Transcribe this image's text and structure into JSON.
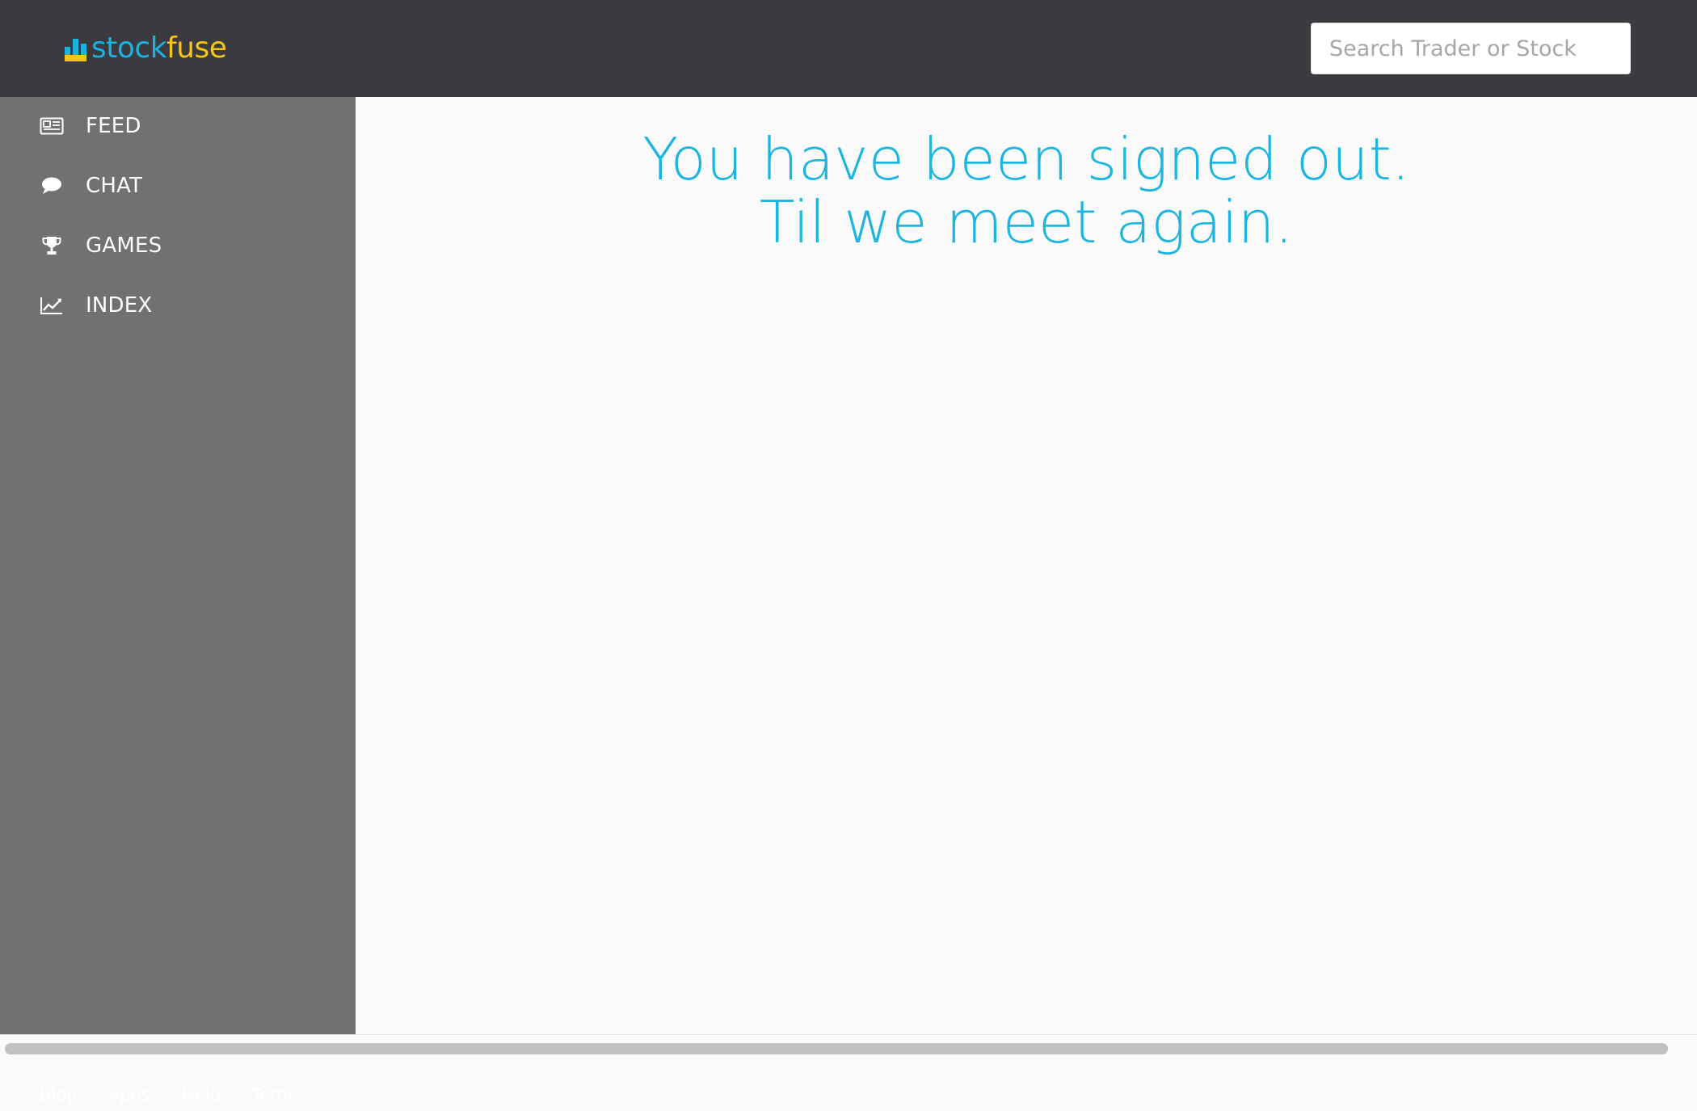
{
  "header": {
    "logo": {
      "part1": "stock",
      "part2": "fuse",
      "colors": {
        "stock": "#1bb4e0",
        "fuse": "#f5c518"
      }
    },
    "search": {
      "placeholder": "Search Trader or Stock",
      "value": ""
    }
  },
  "sidebar": {
    "items": [
      {
        "label": "FEED",
        "icon": "newspaper-icon"
      },
      {
        "label": "CHAT",
        "icon": "speech-bubble-icon"
      },
      {
        "label": "GAMES",
        "icon": "trophy-icon"
      },
      {
        "label": "INDEX",
        "icon": "line-chart-icon"
      }
    ],
    "footer": [
      {
        "label": "Blog"
      },
      {
        "label": "Apps"
      },
      {
        "label": "Help"
      },
      {
        "label": "Terms"
      }
    ]
  },
  "main": {
    "message_line1": "You have been signed out.",
    "message_line2": "Til we meet again."
  },
  "colors": {
    "topbar": "#3a3a3f",
    "sidebar": "#717174",
    "accent": "#1cb5e0",
    "background": "#fafafa"
  }
}
